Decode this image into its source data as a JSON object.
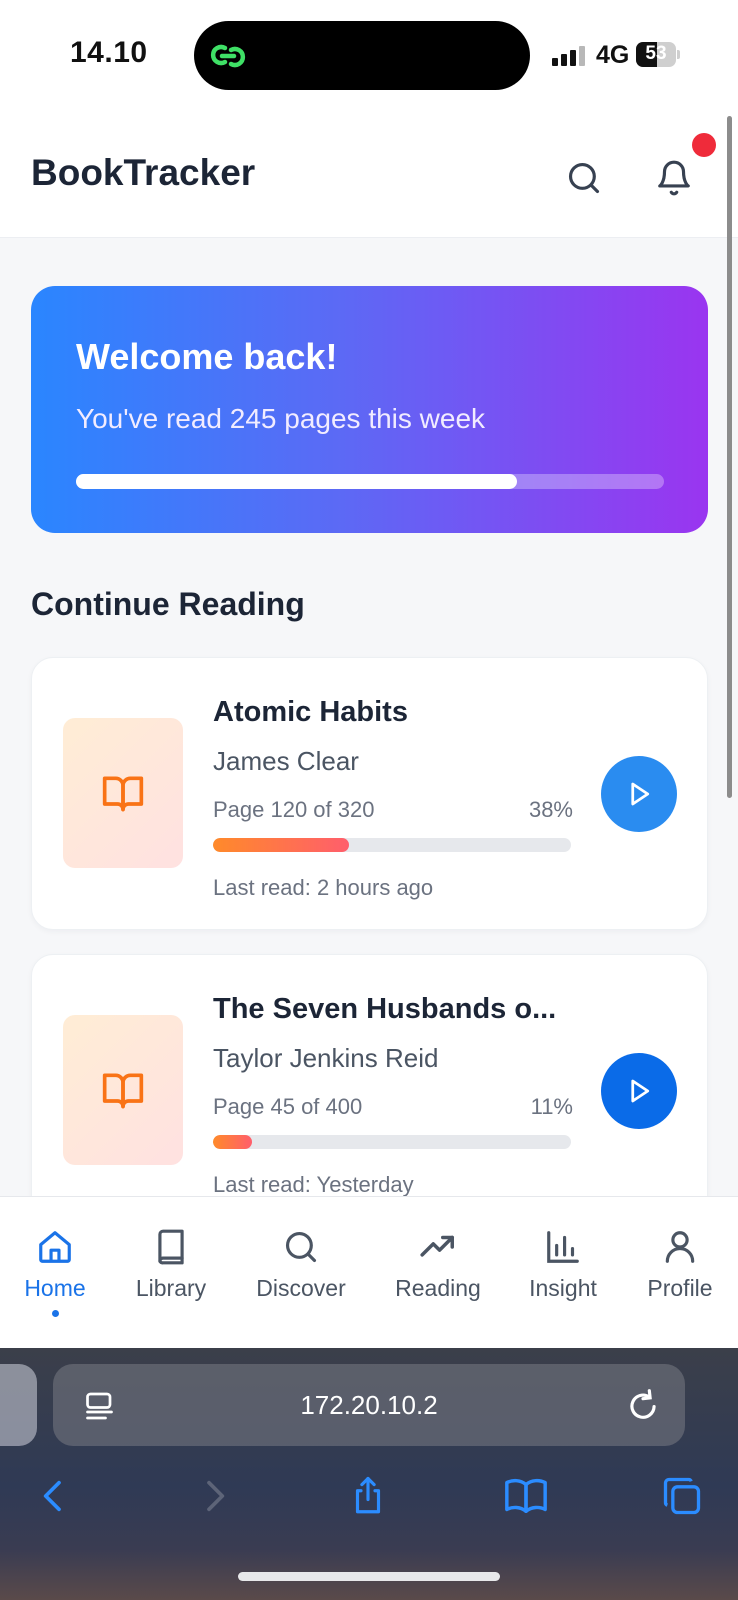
{
  "status_bar": {
    "time": "14.10",
    "network": "4G",
    "battery_level": "53"
  },
  "header": {
    "title": "BookTracker",
    "search_icon": "search-icon",
    "notifications_icon": "bell-icon",
    "has_notification": true
  },
  "welcome": {
    "title": "Welcome back!",
    "subtitle": "You've read 245 pages this week",
    "progress": 0.75
  },
  "section": {
    "title": "Continue Reading"
  },
  "books": [
    {
      "title": "Atomic Habits",
      "author": "James Clear",
      "page_text": "Page 120 of 320",
      "percent_text": "38%",
      "progress": 0.38,
      "last_read": "Last read: 2 hours ago",
      "play_color": "#2a8cf0"
    },
    {
      "title": "The Seven Husbands o...",
      "author": "Taylor Jenkins Reid",
      "page_text": "Page 45 of 400",
      "percent_text": "11%",
      "progress": 0.11,
      "last_read": "Last read: Yesterday",
      "play_color": "#0a6be8"
    }
  ],
  "nav": {
    "items": [
      {
        "label": "Home",
        "icon": "home-icon",
        "active": true
      },
      {
        "label": "Library",
        "icon": "book-icon"
      },
      {
        "label": "Discover",
        "icon": "search-icon"
      },
      {
        "label": "Reading",
        "icon": "trending-up-icon"
      },
      {
        "label": "Insight",
        "icon": "bar-chart-icon"
      },
      {
        "label": "Profile",
        "icon": "user-icon"
      }
    ]
  },
  "browser": {
    "url": "172.20.10.2"
  },
  "colors": {
    "accent": "#1a73e8",
    "banner_start": "#2a86ff",
    "banner_end": "#9a35f0",
    "book_icon": "#f97316",
    "progress_start": "#ff8a2a",
    "progress_end": "#ff5e6c",
    "notification": "#ef2b3a"
  }
}
